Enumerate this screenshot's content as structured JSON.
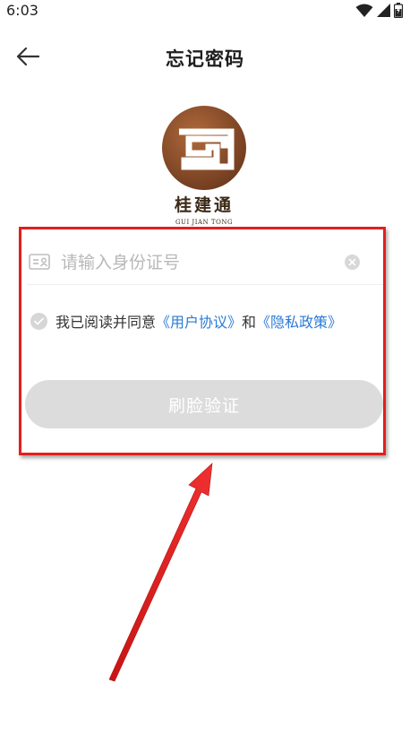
{
  "status_bar": {
    "time": "6:03"
  },
  "header": {
    "title": "忘记密码"
  },
  "logo": {
    "name": "桂建通",
    "subtitle": "GUI JIAN TONG"
  },
  "form": {
    "id_placeholder": "请输入身份证号",
    "agreement_prefix": "我已阅读并同意",
    "user_agreement": "《用户协议》",
    "conjunction": "和",
    "privacy_policy": "《隐私政策》",
    "verify_button": "刷脸验证"
  },
  "colors": {
    "link": "#2a7ad5",
    "button_disabled": "#dcdcdc",
    "annotation_red": "#e41e1e",
    "logo_brown": "#8a5030"
  },
  "icons": [
    "wifi-icon",
    "signal-icon",
    "battery-icon",
    "back-arrow-icon",
    "id-card-icon",
    "clear-icon",
    "check-icon"
  ]
}
